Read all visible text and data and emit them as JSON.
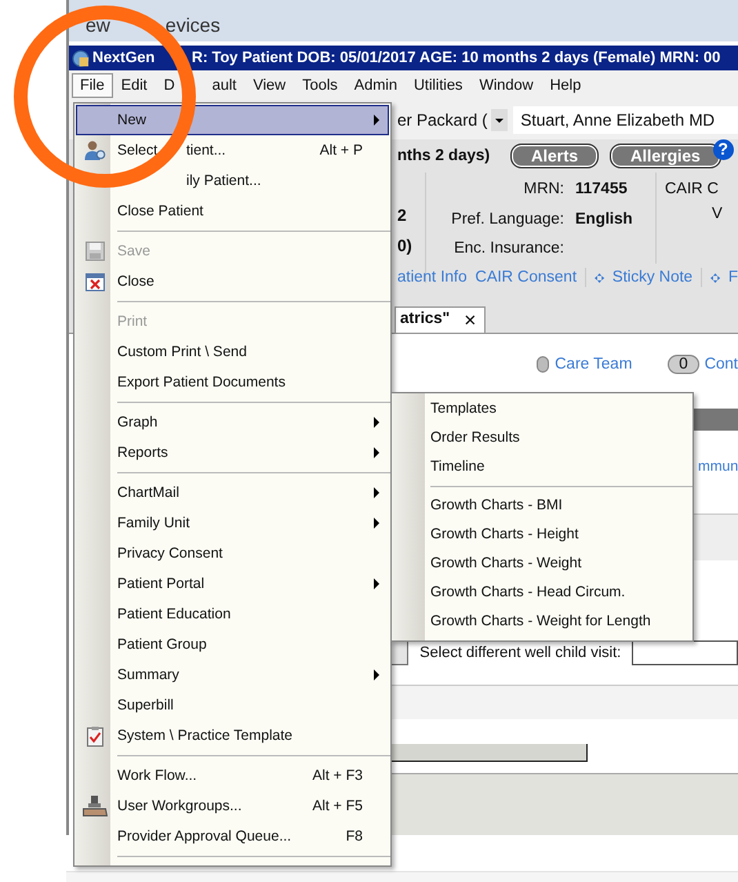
{
  "top_bar": {
    "items": [
      "ew",
      "evices"
    ]
  },
  "window": {
    "title_parts": [
      "NextGen",
      "R: Toy Patient  DOB: 05/01/2017  AGE: 10 months 2 days  (Female)  MRN: 00"
    ]
  },
  "menubar": [
    {
      "label_parts": [
        "File"
      ],
      "selected": true
    },
    {
      "label_parts": [
        "Edit"
      ],
      "selected": false
    },
    {
      "label_parts": [
        "D",
        "ault"
      ],
      "selected": false
    },
    {
      "label_parts": [
        "View"
      ],
      "selected": false
    },
    {
      "label_parts": [
        "Tools"
      ],
      "selected": false
    },
    {
      "label_parts": [
        "Admin"
      ],
      "selected": false
    },
    {
      "label_parts": [
        "Utilities"
      ],
      "selected": false
    },
    {
      "label_parts": [
        "Window"
      ],
      "selected": false
    },
    {
      "label_parts": [
        "Help"
      ],
      "selected": false
    }
  ],
  "toolbar": {
    "location": "er Packard (",
    "provider": "Stuart, Anne Elizabeth MD"
  },
  "banner": {
    "age_fragment": "nths 2 days)",
    "buttons": [
      "Alerts",
      "Allergies"
    ],
    "help": "?",
    "left_fragments": [
      "2",
      "0)"
    ],
    "fields": [
      {
        "label": "MRN:",
        "value": "117455"
      },
      {
        "label": "Pref. Language:",
        "value": "English"
      },
      {
        "label": "Enc. Insurance:"
      }
    ],
    "cair": "CAIR C",
    "cair_value": "V",
    "links": [
      {
        "label": "atient Info",
        "kind": "plain"
      },
      {
        "label": "CAIR Consent",
        "kind": "plain"
      },
      {
        "label": "Sticky Note",
        "kind": "pinned"
      },
      {
        "label": "F",
        "kind": "pinned"
      }
    ]
  },
  "tabs": [
    {
      "label": "atrics\"",
      "close": "✕"
    }
  ],
  "content": {
    "care_team": "Care Team",
    "count": "0",
    "cont": "Cont",
    "link": "mmun",
    "visit_label": "Select different well child visit:"
  },
  "file_menu": [
    [
      {
        "label": "New",
        "selected": true,
        "submenu": true,
        "disabled": false
      },
      {
        "label_parts": [
          "Select",
          "tient..."
        ],
        "shortcut": "Alt + P",
        "selected": false,
        "submenu": false,
        "disabled": false
      },
      {
        "label_parts": [
          "ily Patient..."
        ],
        "selected": false,
        "submenu": false,
        "disabled": false
      },
      {
        "label": "Close Patient",
        "selected": false,
        "submenu": false,
        "disabled": false
      }
    ],
    [
      {
        "label": "Save",
        "selected": false,
        "submenu": false,
        "disabled": true
      },
      {
        "label": "Close",
        "selected": false,
        "submenu": false,
        "disabled": false
      }
    ],
    [
      {
        "label": "Print",
        "selected": false,
        "submenu": false,
        "disabled": true
      },
      {
        "label": "Custom Print \\ Send",
        "selected": false,
        "submenu": false,
        "disabled": false
      },
      {
        "label": "Export Patient Documents",
        "selected": false,
        "submenu": false,
        "disabled": false
      }
    ],
    [
      {
        "label": "Graph",
        "selected": false,
        "submenu": true,
        "disabled": false
      },
      {
        "label": "Reports",
        "selected": false,
        "submenu": true,
        "disabled": false
      }
    ],
    [
      {
        "label": "ChartMail",
        "selected": false,
        "submenu": true,
        "disabled": false
      },
      {
        "label": "Family Unit",
        "selected": false,
        "submenu": true,
        "disabled": false
      },
      {
        "label": "Privacy Consent",
        "selected": false,
        "submenu": false,
        "disabled": false
      },
      {
        "label": "Patient Portal",
        "selected": false,
        "submenu": true,
        "disabled": false
      },
      {
        "label": "Patient Education",
        "selected": false,
        "submenu": false,
        "disabled": false
      },
      {
        "label": "Patient Group",
        "selected": false,
        "submenu": false,
        "disabled": false
      },
      {
        "label": "Summary",
        "selected": false,
        "submenu": true,
        "disabled": false
      },
      {
        "label": "Superbill",
        "selected": false,
        "submenu": false,
        "disabled": false
      },
      {
        "label": "System \\ Practice Template",
        "selected": false,
        "submenu": false,
        "disabled": false
      }
    ],
    [
      {
        "label": "Work Flow...",
        "shortcut": "Alt + F3",
        "selected": false,
        "submenu": false,
        "disabled": false
      },
      {
        "label": "User Workgroups...",
        "shortcut": "Alt + F5",
        "selected": false,
        "submenu": false,
        "disabled": false
      },
      {
        "label": "Provider Approval Queue...",
        "shortcut": "F8",
        "selected": false,
        "submenu": false,
        "disabled": false
      }
    ]
  ],
  "graph_submenu": [
    [
      "Templates",
      "Order Results",
      "Timeline"
    ],
    [
      "Growth Charts - BMI",
      "Growth Charts - Height",
      "Growth Charts - Weight",
      "Growth Charts - Head Circum.",
      "Growth Charts - Weight for Length"
    ]
  ]
}
